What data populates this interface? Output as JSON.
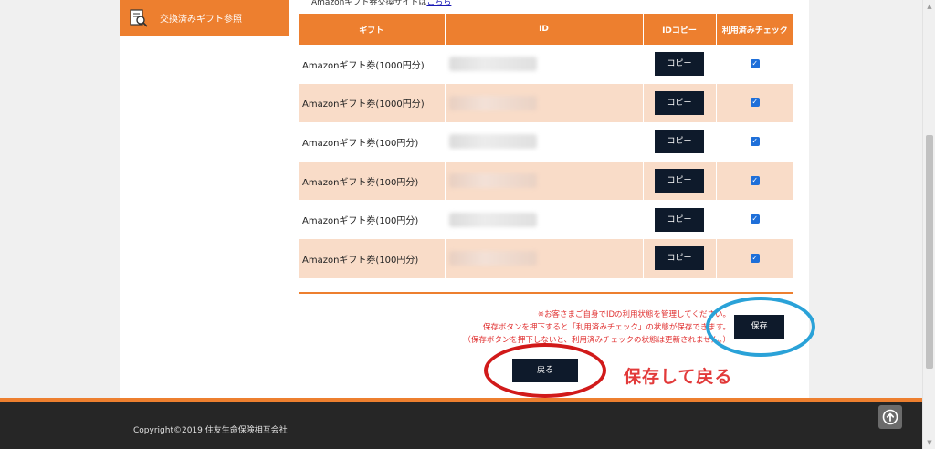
{
  "sidebar": {
    "items": [
      {
        "label": "交換済みギフト参照",
        "icon": "search-document-icon"
      }
    ]
  },
  "intro": {
    "text": "Amazonギフト券交換サイトは",
    "link_text": "こちら"
  },
  "table": {
    "headers": [
      "ギフト",
      "ID",
      "IDコピー",
      "利用済みチェック"
    ],
    "rows": [
      {
        "gift": "Amazonギフト券(1000円分)",
        "copy_label": "コピー",
        "checked": true
      },
      {
        "gift": "Amazonギフト券(1000円分)",
        "copy_label": "コピー",
        "checked": true
      },
      {
        "gift": "Amazonギフト券(100円分)",
        "copy_label": "コピー",
        "checked": true
      },
      {
        "gift": "Amazonギフト券(100円分)",
        "copy_label": "コピー",
        "checked": true
      },
      {
        "gift": "Amazonギフト券(100円分)",
        "copy_label": "コピー",
        "checked": true
      },
      {
        "gift": "Amazonギフト券(100円分)",
        "copy_label": "コピー",
        "checked": true
      }
    ]
  },
  "notes": [
    "※お客さまご自身でIDの利用状態を管理してください。",
    "保存ボタンを押下すると「利用済みチェック」の状態が保存できます。",
    "（保存ボタンを押下しないと、利用済みチェックの状態は更新されません。）"
  ],
  "buttons": {
    "save_label": "保存",
    "back_label": "戻る"
  },
  "annotation": {
    "text": "保存して戻る"
  },
  "footer": {
    "copyright": "Copyright©2019 住友生命保険相互会社"
  },
  "colors": {
    "accent": "#ed7f2f",
    "row_alt": "#f9dcc8",
    "button": "#0e1a2b",
    "ring_blue": "#2aa2d8",
    "ring_red": "#d11a1a"
  }
}
